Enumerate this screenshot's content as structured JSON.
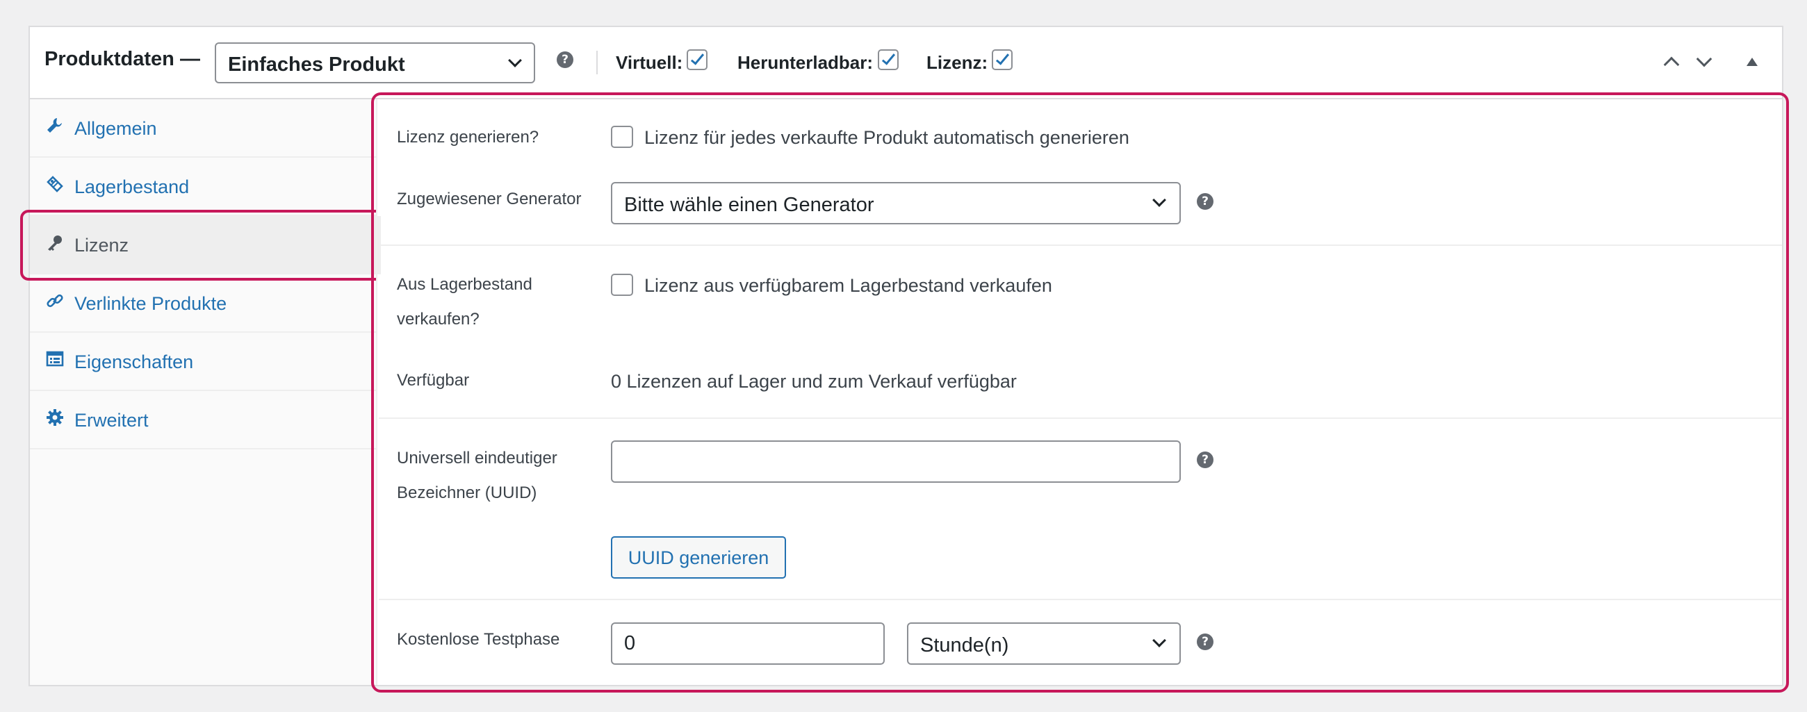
{
  "header": {
    "title": "Produktdaten —",
    "product_type": "Einfaches Produkt",
    "help": "?",
    "virtual_label": "Virtuell:",
    "virtual_checked": true,
    "downloadable_label": "Herunterladbar:",
    "downloadable_checked": true,
    "license_label": "Lizenz:",
    "license_checked": true
  },
  "sidebar": {
    "items": [
      {
        "label": "Allgemein",
        "icon": "wrench-icon"
      },
      {
        "label": "Lagerbestand",
        "icon": "tag-icon"
      },
      {
        "label": "Lizenz",
        "icon": "key-icon",
        "active": true
      },
      {
        "label": "Verlinkte Produkte",
        "icon": "link-icon"
      },
      {
        "label": "Eigenschaften",
        "icon": "list-icon"
      },
      {
        "label": "Erweitert",
        "icon": "gear-icon"
      }
    ]
  },
  "main": {
    "generate_license": {
      "label": "Lizenz generieren?",
      "checkbox_text": "Lizenz für jedes verkaufte Produkt automatisch generieren",
      "checked": false
    },
    "generator": {
      "label": "Zugewiesener Generator",
      "selected": "Bitte wähle einen Generator"
    },
    "sell_from_stock": {
      "label": "Aus Lagerbestand verkaufen?",
      "checkbox_text": "Lizenz aus verfügbarem Lagerbestand verkaufen",
      "checked": false
    },
    "available": {
      "label": "Verfügbar",
      "value": "0 Lizenzen auf Lager und zum Verkauf verfügbar"
    },
    "uuid": {
      "label": "Universell eindeutiger Bezeichner (UUID)",
      "value": "",
      "button": "UUID generieren"
    },
    "trial": {
      "label": "Kostenlose Testphase",
      "value": "0",
      "unit": "Stunde(n)"
    }
  },
  "colors": {
    "accent": "#2271b1",
    "highlight": "#c7185a"
  }
}
